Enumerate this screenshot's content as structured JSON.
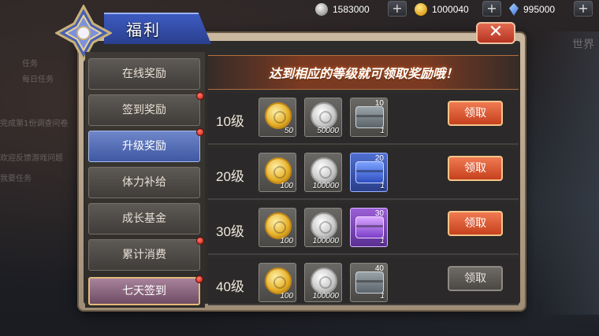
{
  "currency": {
    "silver": "1583000",
    "gold": "1000040",
    "gem": "995000",
    "plus": "+"
  },
  "panel": {
    "title": "福利",
    "close": "✕",
    "banner": "达到相应的等级就可领取奖励哦！"
  },
  "background": {
    "right_label": "世界",
    "left_texts": [
      "任务",
      "每日任务",
      "完成第1份调查问卷",
      "欢迎反馈游戏问题",
      "我要任务"
    ]
  },
  "sidebar": [
    {
      "label": "在线奖励",
      "active": false,
      "dot": false
    },
    {
      "label": "签到奖励",
      "active": false,
      "dot": true
    },
    {
      "label": "升级奖励",
      "active": true,
      "dot": true
    },
    {
      "label": "体力补给",
      "active": false,
      "dot": false
    },
    {
      "label": "成长基金",
      "active": false,
      "dot": false
    },
    {
      "label": "累计消费",
      "active": false,
      "dot": true
    },
    {
      "label": "七天签到",
      "active": false,
      "dot": true,
      "special": true
    }
  ],
  "rewards": [
    {
      "level": "10级",
      "gold_qty": "50",
      "silver_qty": "50000",
      "chest_level": "10",
      "chest_qty": "1",
      "chest_color": "grey",
      "claim": "领取",
      "claimable": true
    },
    {
      "level": "20级",
      "gold_qty": "100",
      "silver_qty": "100000",
      "chest_level": "20",
      "chest_qty": "1",
      "chest_color": "blue",
      "claim": "领取",
      "claimable": true
    },
    {
      "level": "30级",
      "gold_qty": "100",
      "silver_qty": "100000",
      "chest_level": "30",
      "chest_qty": "1",
      "chest_color": "purple",
      "claim": "领取",
      "claimable": true
    },
    {
      "level": "40级",
      "gold_qty": "100",
      "silver_qty": "100000",
      "chest_level": "40",
      "chest_qty": "1",
      "chest_color": "grey",
      "claim": "领取",
      "claimable": false
    }
  ]
}
